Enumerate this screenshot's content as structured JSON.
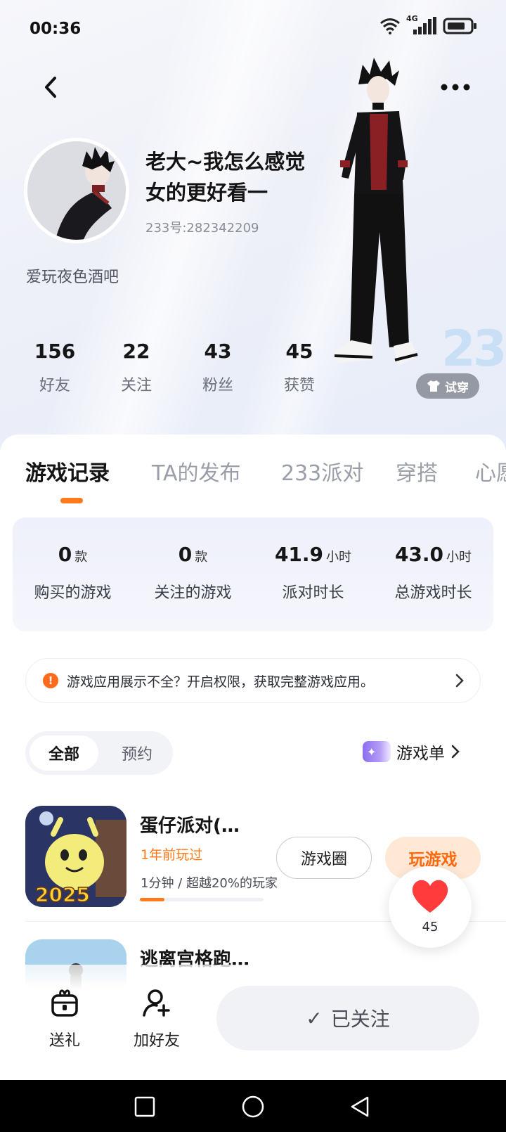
{
  "status_bar": {
    "time": "00:36",
    "network": "4G"
  },
  "profile": {
    "nickname": "老大~我怎么感觉女的更好看一",
    "uid": "233号:282342209",
    "bio": "爱玩夜色酒吧",
    "try_on_label": "试穿",
    "deco_text": "233",
    "stats": [
      {
        "value": "156",
        "label": "好友"
      },
      {
        "value": "22",
        "label": "关注"
      },
      {
        "value": "43",
        "label": "粉丝"
      },
      {
        "value": "45",
        "label": "获赞"
      }
    ]
  },
  "tabs": [
    "游戏记录",
    "TA的发布",
    "233派对",
    "穿搭",
    "心愿"
  ],
  "summary": [
    {
      "value": "0",
      "unit": "款",
      "label": "购买的游戏"
    },
    {
      "value": "0",
      "unit": "款",
      "label": "关注的游戏"
    },
    {
      "value": "41.9",
      "unit": "小时",
      "label": "派对时长"
    },
    {
      "value": "43.0",
      "unit": "小时",
      "label": "总游戏时长"
    }
  ],
  "notice": {
    "icon": "!",
    "text": "游戏应用展示不全？开启权限，获取完整游戏应用。"
  },
  "filter": {
    "all": "全部",
    "reserve": "预约"
  },
  "game_list_link": {
    "label": "游戏单",
    "icon_glyph": "✦"
  },
  "games": [
    {
      "title": "蛋仔派对(…",
      "played": "1年前玩过",
      "stat": "1分钟 / 超越20%的玩家",
      "progress": 0.2,
      "circle_label": "游戏圈",
      "play_label": "玩游戏",
      "icon_caption": "2025"
    },
    {
      "title": "逃离宫格跑…",
      "played": "",
      "stat": "",
      "progress": 0,
      "circle_label": "",
      "play_label": ""
    }
  ],
  "like": {
    "count": "45",
    "color": "#ff3b3b"
  },
  "bottom_bar": {
    "gift_label": "送礼",
    "add_friend_label": "加好友",
    "followed_label": "已关注",
    "check_glyph": "✓"
  },
  "colors": {
    "accent": "#ff7a1a",
    "play_bg": "#ffe9d6",
    "summary_bg": "#eef0fb"
  }
}
